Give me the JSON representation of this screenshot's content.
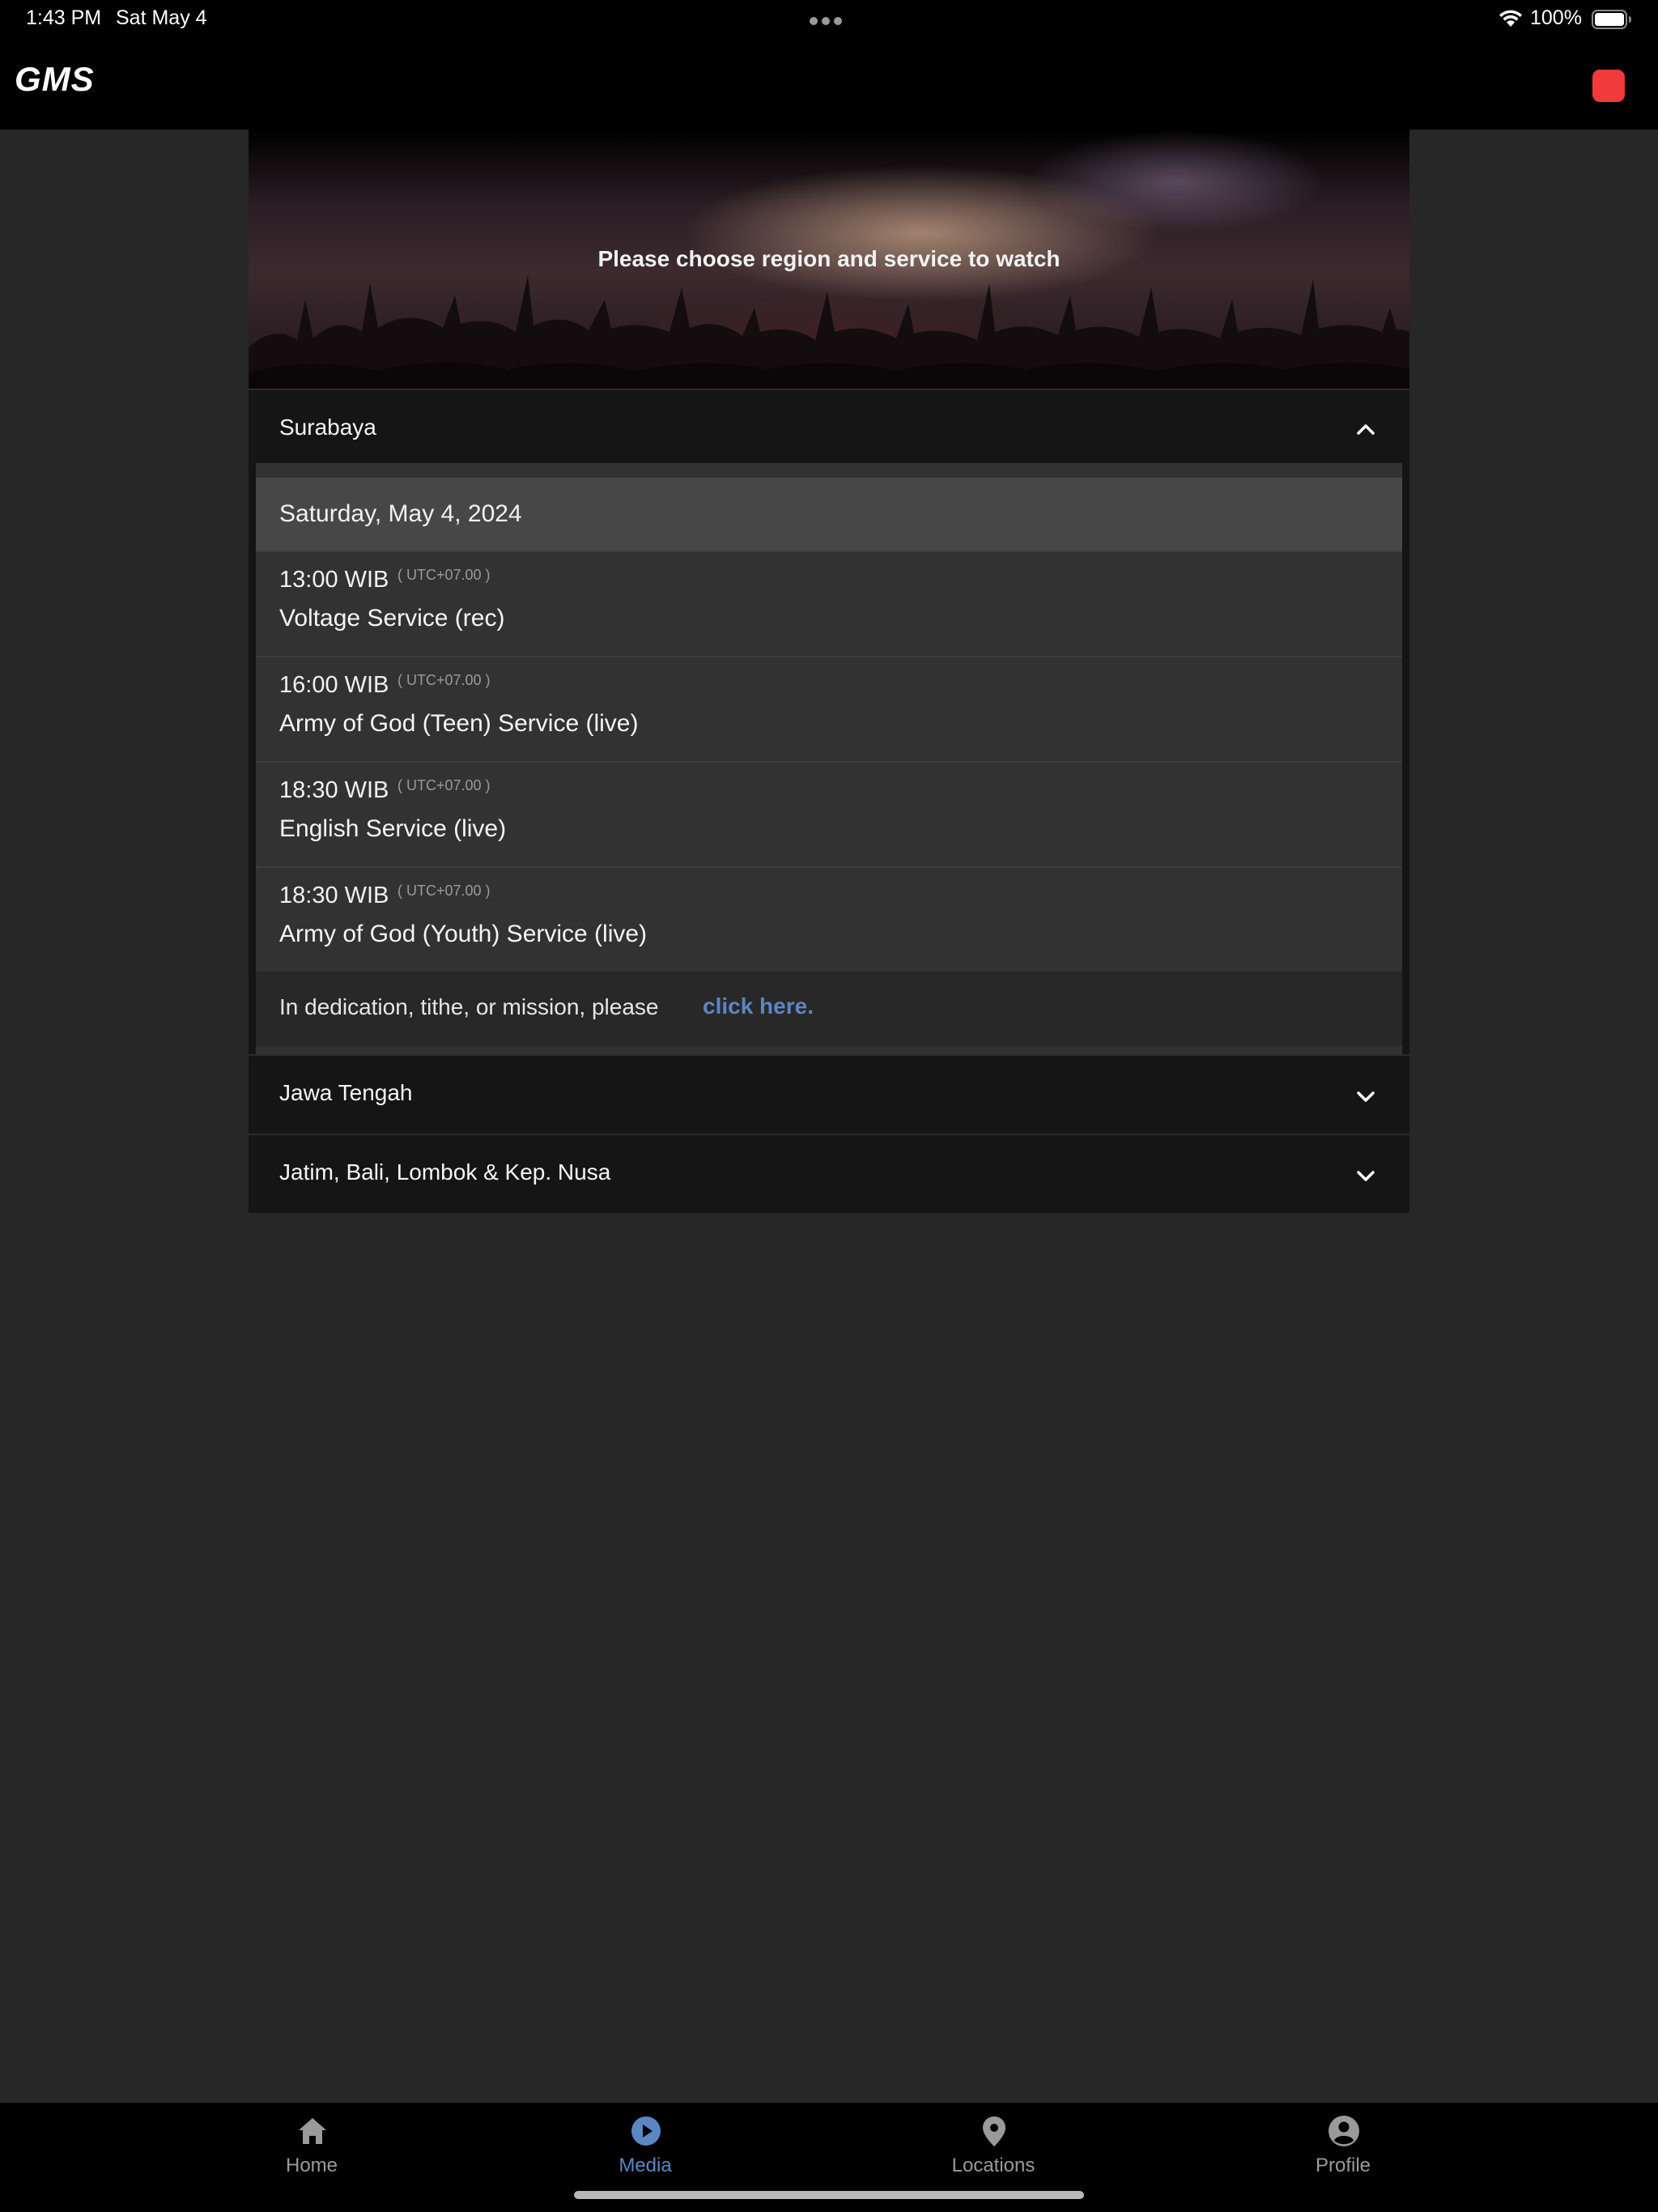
{
  "status_bar": {
    "time": "1:43 PM",
    "date": "Sat May 4",
    "battery": "100%"
  },
  "header": {
    "logo": "GMS",
    "record_color": "#f03a3c"
  },
  "hero": {
    "prompt": "Please choose region and service to watch"
  },
  "regions": [
    {
      "name": "Surabaya",
      "expanded": true,
      "date": "Saturday, May 4, 2024",
      "services": [
        {
          "time": "13:00 WIB",
          "tz": "( UTC+07.00 )",
          "name": "Voltage Service (rec)"
        },
        {
          "time": "16:00 WIB",
          "tz": "( UTC+07.00 )",
          "name": "Army of God (Teen) Service (live)"
        },
        {
          "time": "18:30 WIB",
          "tz": "( UTC+07.00 )",
          "name": "English Service (live)"
        },
        {
          "time": "18:30 WIB",
          "tz": "( UTC+07.00 )",
          "name": "Army of God (Youth) Service (live)"
        }
      ],
      "footer_text": "In dedication, tithe, or mission, please",
      "footer_link": "click here."
    },
    {
      "name": "Jawa Tengah",
      "expanded": false
    },
    {
      "name": "Jatim, Bali, Lombok & Kep. Nusa",
      "expanded": false
    }
  ],
  "tabs": [
    {
      "label": "Home",
      "icon": "home-icon",
      "active": false
    },
    {
      "label": "Media",
      "icon": "play-circle-icon",
      "active": true
    },
    {
      "label": "Locations",
      "icon": "location-pin-icon",
      "active": false
    },
    {
      "label": "Profile",
      "icon": "profile-icon",
      "active": false
    }
  ],
  "colors": {
    "accent": "#5b86c4",
    "background": "#272727",
    "header": "#000000"
  }
}
